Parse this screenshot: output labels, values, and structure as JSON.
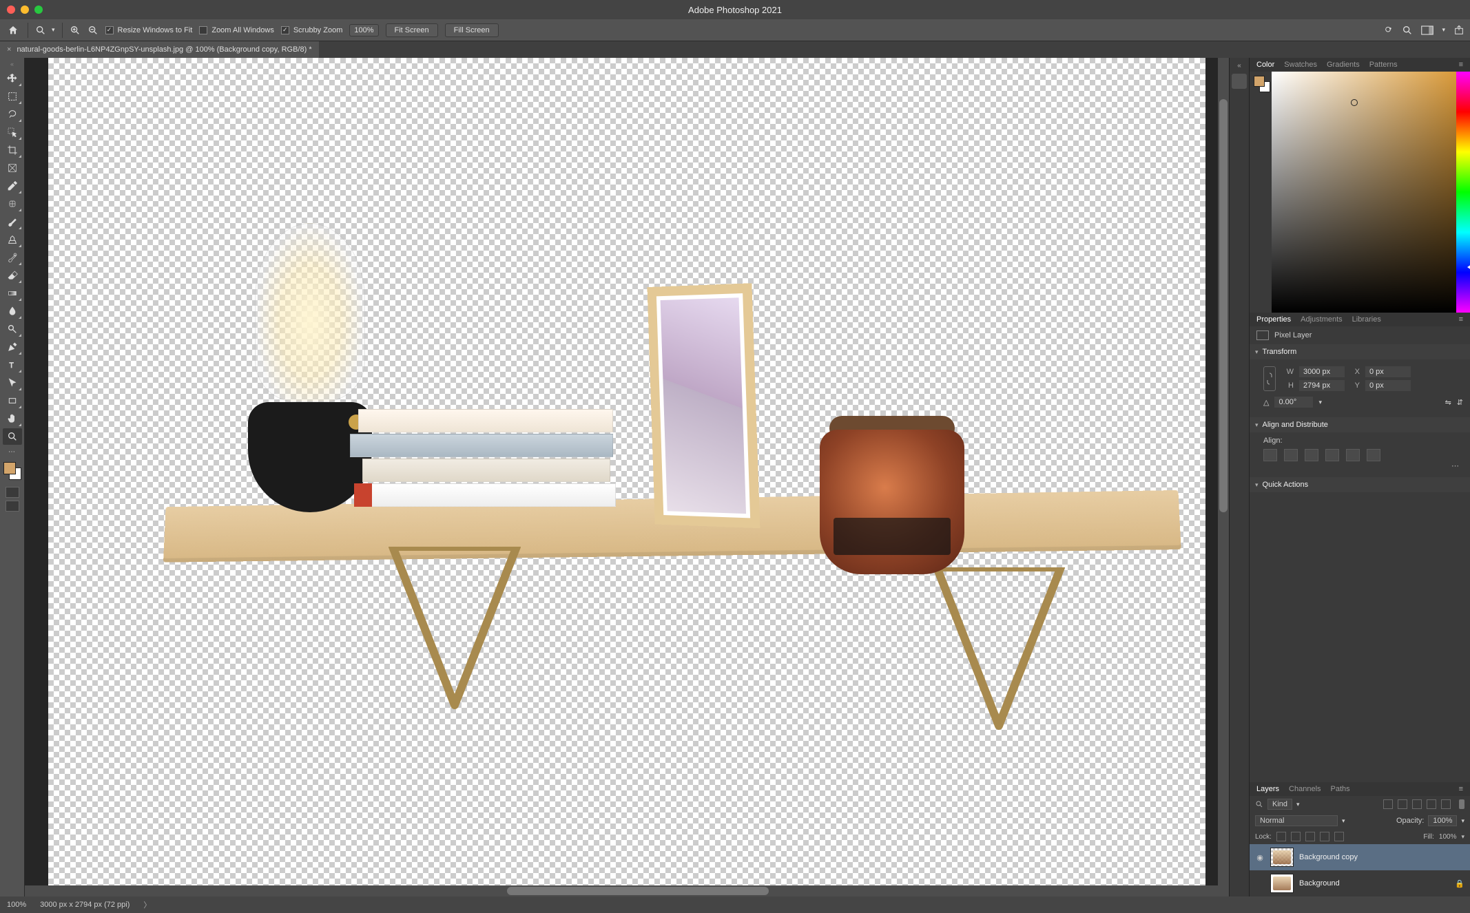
{
  "app": {
    "title": "Adobe Photoshop 2021"
  },
  "optbar": {
    "resize_label": "Resize Windows to Fit",
    "zoom_all_label": "Zoom All Windows",
    "scrubby_label": "Scrubby Zoom",
    "zoom_pct": "100%",
    "fit_screen": "Fit Screen",
    "fill_screen": "Fill Screen",
    "resize_checked": true,
    "zoom_all_checked": false,
    "scrubby_checked": true
  },
  "doc": {
    "tab_label": "natural-goods-berlin-L6NP4ZGnpSY-unsplash.jpg @ 100% (Background copy, RGB/8) *"
  },
  "tools": [
    "move",
    "marquee",
    "lasso",
    "object-select",
    "crop",
    "frame",
    "eyedropper",
    "patch",
    "brush",
    "clone",
    "history-brush",
    "eraser",
    "gradient",
    "blur",
    "dodge",
    "pen",
    "type",
    "path-select",
    "rectangle",
    "hand",
    "zoom"
  ],
  "active_tool": "zoom",
  "panel_group1": {
    "tabs": [
      "Color",
      "Swatches",
      "Gradients",
      "Patterns"
    ],
    "active": "Color"
  },
  "panel_group2": {
    "tabs": [
      "Properties",
      "Adjustments",
      "Libraries"
    ],
    "active": "Properties"
  },
  "panel_group3": {
    "tabs": [
      "Layers",
      "Channels",
      "Paths"
    ],
    "active": "Layers"
  },
  "properties": {
    "kind_label": "Pixel Layer",
    "transform_head": "Transform",
    "W": "3000 px",
    "H": "2794 px",
    "X": "0 px",
    "Y": "0 px",
    "angle": "0.00°",
    "align_head": "Align and Distribute",
    "align_sub": "Align:",
    "quick_head": "Quick Actions"
  },
  "layers_panel": {
    "kind_label": "Kind",
    "blend_mode": "Normal",
    "opacity_label": "Opacity:",
    "opacity_value": "100%",
    "lock_label": "Lock:",
    "fill_label": "Fill:",
    "fill_value": "100%",
    "layers": [
      {
        "name": "Background copy",
        "visible": true,
        "selected": true,
        "locked": false
      },
      {
        "name": "Background",
        "visible": false,
        "selected": false,
        "locked": true
      }
    ]
  },
  "status": {
    "zoom": "100%",
    "dims": "3000 px x 2794 px (72 ppi)"
  },
  "colors": {
    "fg": "#d2a46a",
    "bg": "#ffffff"
  }
}
